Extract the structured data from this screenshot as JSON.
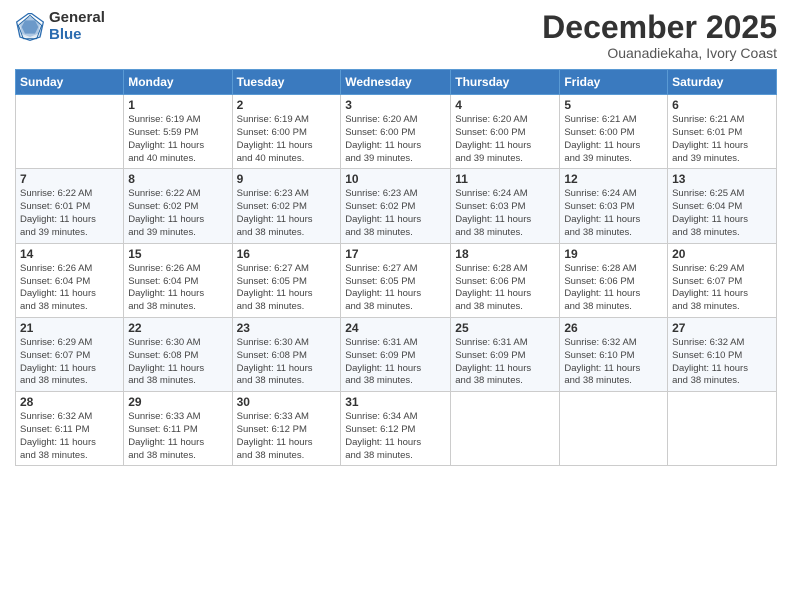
{
  "logo": {
    "general": "General",
    "blue": "Blue"
  },
  "title": "December 2025",
  "subtitle": "Ouanadiekaha, Ivory Coast",
  "days_of_week": [
    "Sunday",
    "Monday",
    "Tuesday",
    "Wednesday",
    "Thursday",
    "Friday",
    "Saturday"
  ],
  "weeks": [
    [
      {
        "day": "",
        "info": ""
      },
      {
        "day": "1",
        "info": "Sunrise: 6:19 AM\nSunset: 5:59 PM\nDaylight: 11 hours\nand 40 minutes."
      },
      {
        "day": "2",
        "info": "Sunrise: 6:19 AM\nSunset: 6:00 PM\nDaylight: 11 hours\nand 40 minutes."
      },
      {
        "day": "3",
        "info": "Sunrise: 6:20 AM\nSunset: 6:00 PM\nDaylight: 11 hours\nand 39 minutes."
      },
      {
        "day": "4",
        "info": "Sunrise: 6:20 AM\nSunset: 6:00 PM\nDaylight: 11 hours\nand 39 minutes."
      },
      {
        "day": "5",
        "info": "Sunrise: 6:21 AM\nSunset: 6:00 PM\nDaylight: 11 hours\nand 39 minutes."
      },
      {
        "day": "6",
        "info": "Sunrise: 6:21 AM\nSunset: 6:01 PM\nDaylight: 11 hours\nand 39 minutes."
      }
    ],
    [
      {
        "day": "7",
        "info": "Sunrise: 6:22 AM\nSunset: 6:01 PM\nDaylight: 11 hours\nand 39 minutes."
      },
      {
        "day": "8",
        "info": "Sunrise: 6:22 AM\nSunset: 6:02 PM\nDaylight: 11 hours\nand 39 minutes."
      },
      {
        "day": "9",
        "info": "Sunrise: 6:23 AM\nSunset: 6:02 PM\nDaylight: 11 hours\nand 38 minutes."
      },
      {
        "day": "10",
        "info": "Sunrise: 6:23 AM\nSunset: 6:02 PM\nDaylight: 11 hours\nand 38 minutes."
      },
      {
        "day": "11",
        "info": "Sunrise: 6:24 AM\nSunset: 6:03 PM\nDaylight: 11 hours\nand 38 minutes."
      },
      {
        "day": "12",
        "info": "Sunrise: 6:24 AM\nSunset: 6:03 PM\nDaylight: 11 hours\nand 38 minutes."
      },
      {
        "day": "13",
        "info": "Sunrise: 6:25 AM\nSunset: 6:04 PM\nDaylight: 11 hours\nand 38 minutes."
      }
    ],
    [
      {
        "day": "14",
        "info": "Sunrise: 6:26 AM\nSunset: 6:04 PM\nDaylight: 11 hours\nand 38 minutes."
      },
      {
        "day": "15",
        "info": "Sunrise: 6:26 AM\nSunset: 6:04 PM\nDaylight: 11 hours\nand 38 minutes."
      },
      {
        "day": "16",
        "info": "Sunrise: 6:27 AM\nSunset: 6:05 PM\nDaylight: 11 hours\nand 38 minutes."
      },
      {
        "day": "17",
        "info": "Sunrise: 6:27 AM\nSunset: 6:05 PM\nDaylight: 11 hours\nand 38 minutes."
      },
      {
        "day": "18",
        "info": "Sunrise: 6:28 AM\nSunset: 6:06 PM\nDaylight: 11 hours\nand 38 minutes."
      },
      {
        "day": "19",
        "info": "Sunrise: 6:28 AM\nSunset: 6:06 PM\nDaylight: 11 hours\nand 38 minutes."
      },
      {
        "day": "20",
        "info": "Sunrise: 6:29 AM\nSunset: 6:07 PM\nDaylight: 11 hours\nand 38 minutes."
      }
    ],
    [
      {
        "day": "21",
        "info": "Sunrise: 6:29 AM\nSunset: 6:07 PM\nDaylight: 11 hours\nand 38 minutes."
      },
      {
        "day": "22",
        "info": "Sunrise: 6:30 AM\nSunset: 6:08 PM\nDaylight: 11 hours\nand 38 minutes."
      },
      {
        "day": "23",
        "info": "Sunrise: 6:30 AM\nSunset: 6:08 PM\nDaylight: 11 hours\nand 38 minutes."
      },
      {
        "day": "24",
        "info": "Sunrise: 6:31 AM\nSunset: 6:09 PM\nDaylight: 11 hours\nand 38 minutes."
      },
      {
        "day": "25",
        "info": "Sunrise: 6:31 AM\nSunset: 6:09 PM\nDaylight: 11 hours\nand 38 minutes."
      },
      {
        "day": "26",
        "info": "Sunrise: 6:32 AM\nSunset: 6:10 PM\nDaylight: 11 hours\nand 38 minutes."
      },
      {
        "day": "27",
        "info": "Sunrise: 6:32 AM\nSunset: 6:10 PM\nDaylight: 11 hours\nand 38 minutes."
      }
    ],
    [
      {
        "day": "28",
        "info": "Sunrise: 6:32 AM\nSunset: 6:11 PM\nDaylight: 11 hours\nand 38 minutes."
      },
      {
        "day": "29",
        "info": "Sunrise: 6:33 AM\nSunset: 6:11 PM\nDaylight: 11 hours\nand 38 minutes."
      },
      {
        "day": "30",
        "info": "Sunrise: 6:33 AM\nSunset: 6:12 PM\nDaylight: 11 hours\nand 38 minutes."
      },
      {
        "day": "31",
        "info": "Sunrise: 6:34 AM\nSunset: 6:12 PM\nDaylight: 11 hours\nand 38 minutes."
      },
      {
        "day": "",
        "info": ""
      },
      {
        "day": "",
        "info": ""
      },
      {
        "day": "",
        "info": ""
      }
    ]
  ]
}
